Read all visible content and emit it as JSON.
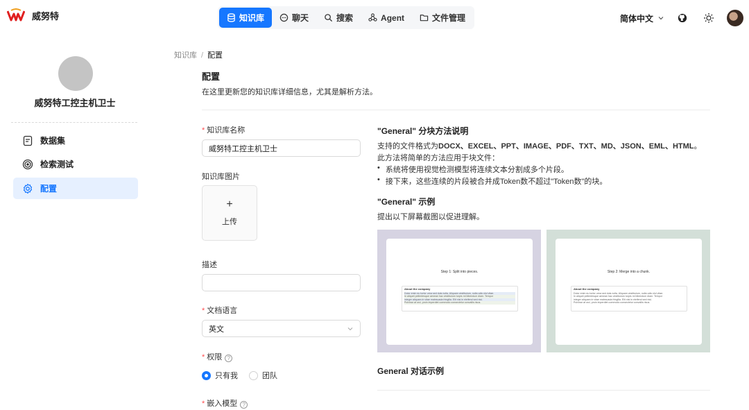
{
  "brand": {
    "name": "威努特"
  },
  "nav": {
    "items": [
      {
        "label": "知识库",
        "icon": "database-icon",
        "active": true
      },
      {
        "label": "聊天",
        "icon": "chat-icon",
        "active": false
      },
      {
        "label": "搜索",
        "icon": "search-icon",
        "active": false
      },
      {
        "label": "Agent",
        "icon": "agent-icon",
        "active": false
      },
      {
        "label": "文件管理",
        "icon": "folder-icon",
        "active": false
      }
    ]
  },
  "header": {
    "language": "简体中文"
  },
  "sidebar": {
    "kb_name": "威努特工控主机卫士",
    "items": [
      {
        "label": "数据集",
        "icon": "dataset-icon",
        "active": false
      },
      {
        "label": "检索测试",
        "icon": "target-icon",
        "active": false
      },
      {
        "label": "配置",
        "icon": "gear-icon",
        "active": true
      }
    ]
  },
  "breadcrumb": {
    "root": "知识库",
    "separator": "/",
    "current": "配置"
  },
  "page": {
    "title": "配置",
    "description": "在这里更新您的知识库详细信息，尤其是解析方法。"
  },
  "form": {
    "name_label": "知识库名称",
    "name_value": "威努特工控主机卫士",
    "image_label": "知识库图片",
    "upload_label": "上传",
    "desc_label": "描述",
    "desc_value": "",
    "lang_label": "文档语言",
    "lang_value": "英文",
    "perm_label": "权限",
    "perm_options": [
      {
        "label": "只有我",
        "selected": true
      },
      {
        "label": "团队",
        "selected": false
      }
    ],
    "embed_label": "嵌入模型"
  },
  "method": {
    "title": "\"General\" 分块方法说明",
    "formats_prefix": "支持的文件格式为",
    "formats": "DOCX、EXCEL、PPT、IMAGE、PDF、TXT、MD、JSON、EML、HTML",
    "formats_suffix": "。",
    "intro": "此方法将简单的方法应用于块文件：",
    "bullets": [
      "系统将使用视觉检测模型将连续文本分割成多个片段。",
      "接下来，这些连续的片段被合并成Token数不超过\"Token数\"的块。"
    ],
    "example_title": "\"General\" 示例",
    "example_desc": "提出以下屏幕截图以促进理解。",
    "shots": [
      {
        "bg": "#d6d3e2",
        "heading": "Step 1: Split into pieces.",
        "box_title": "About the company",
        "lines": [
          "Dolor enim eu tortor urna sed duis nulla. Aliquam vestibulum, nulla odio nisl vitae.",
          "In aliquet pellentesque aenean hac vestibulum turpis mi bibendum diam. Tempor",
          "integer aliquam in vitae malesuada fringilla. Elit nisi in eleifend sed nisi.",
          "Pulvinar at orci, proin imperdiet commodo consectetur convallis risus."
        ]
      },
      {
        "bg": "#d3dfd8",
        "heading": "Step 2: Merge into a chunk.",
        "box_title": "About the company",
        "lines": [
          "Dolor enim eu tortor urna sed duis nulla. Aliquam vestibulum, nulla odio nisl vitae.",
          "In aliquet pellentesque aenean hac vestibulum turpis mi bibendum diam. Tempor",
          "integer aliquam in vitae malesuada fringilla. Elit nisi in eleifend sed nisi.",
          "Pulvinar at orci, proin imperdiet commodo consectetur convallis risus."
        ]
      }
    ],
    "dialog_title": "General 对话示例"
  },
  "colors": {
    "accent": "#1677ff",
    "required": "#ff4d4f",
    "logo": "#e02020"
  }
}
